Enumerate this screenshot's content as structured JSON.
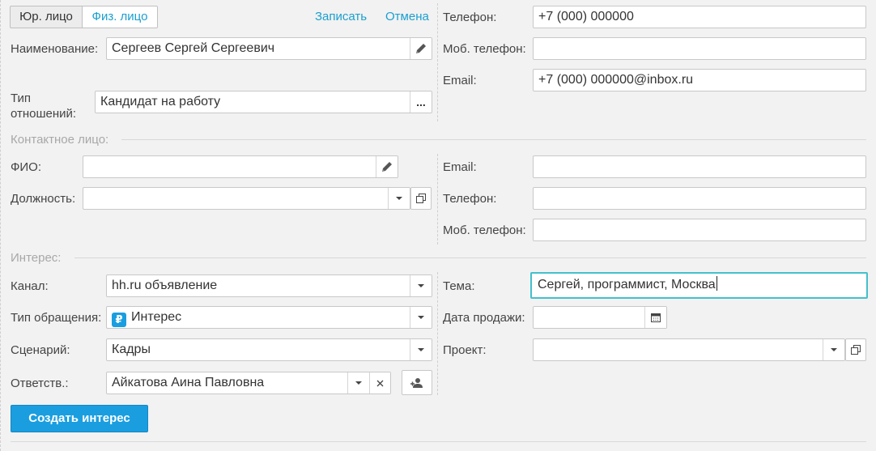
{
  "toggle": {
    "legal_label": "Юр. лицо",
    "individual_label": "Физ. лицо"
  },
  "actions": {
    "save": "Записать",
    "cancel": "Отмена"
  },
  "main": {
    "name_label": "Наименование:",
    "name_value": "Сергеев Сергей Сергеевич",
    "relation_label": "Тип отношений:",
    "relation_value": "Кандидат на работу",
    "more_glyph": "...",
    "phone_label": "Телефон:",
    "phone_value": "+7 (000) 000000",
    "mobile_label": "Моб. телефон:",
    "mobile_value": "",
    "email_label": "Email:",
    "email_value": "+7 (000) 000000@inbox.ru"
  },
  "contact": {
    "section": "Контактное лицо:",
    "fio_label": "ФИО:",
    "fio_value": "",
    "position_label": "Должность:",
    "position_value": "",
    "email_label": "Email:",
    "email_value": "",
    "phone_label": "Телефон:",
    "phone_value": "",
    "mobile_label": "Моб. телефон:",
    "mobile_value": ""
  },
  "interest": {
    "section": "Интерес:",
    "channel_label": "Канал:",
    "channel_value": "hh.ru объявление",
    "request_type_label": "Тип обращения:",
    "request_type_value": "Интерес",
    "request_type_icon_glyph": "₽",
    "scenario_label": "Сценарий:",
    "scenario_value": "Кадры",
    "responsible_label": "Ответств.:",
    "responsible_value": "Айкатова Аина Павловна",
    "topic_label": "Тема:",
    "topic_value": "Сергей, программист, Москва",
    "sale_date_label": "Дата продажи:",
    "sale_date_value": "  .  .",
    "project_label": "Проект:",
    "project_value": ""
  },
  "create_button": "Создать интерес",
  "icons": {
    "edit": "pencil-icon",
    "dropdown": "chevron-down-icon",
    "open": "open-window-icon",
    "clear": "close-icon",
    "calendar": "calendar-icon",
    "user_add": "user-add-icon",
    "request_type": "ruble-icon"
  },
  "colors": {
    "accent": "#1a9ee0",
    "link": "#1a9fd0",
    "focus": "#44c0cc"
  }
}
